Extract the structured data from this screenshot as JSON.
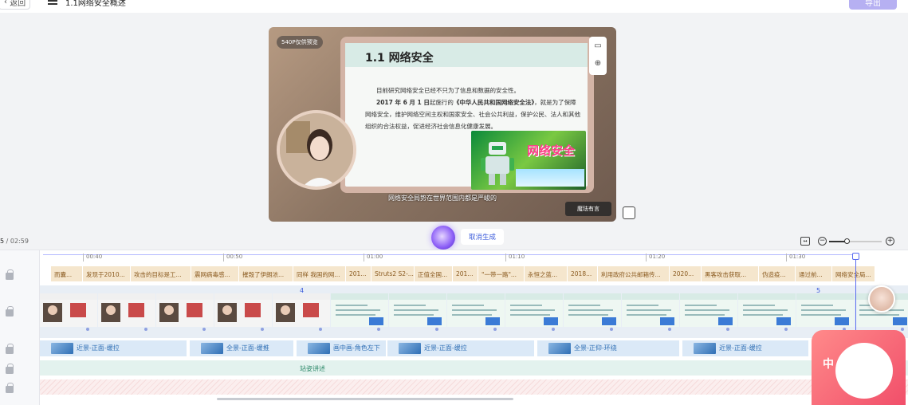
{
  "header": {
    "back_label": "返回",
    "title": "1.1网络安全概述",
    "export_label": "导出"
  },
  "preview": {
    "badge": "540P仅供预览",
    "slide_title": "1.1  网络安全",
    "slide_p1": "目前研究网络安全已经不只为了信息和数据的安全性。",
    "slide_p2_bold": "2017 年 6 月 1 日",
    "slide_p2_mid": "起施行的",
    "slide_p2_law": "《中华人民共和国网络安全法》",
    "slide_p2_rest": "，就是为了保障网络安全，维护网络空间主权和国家安全、社会公共利益，保护公民、法人和其他组织的合法权益，促进经济社会信息化健康发展。",
    "poster_text": "网络安全",
    "subtitle": "网络安全局势在世界范围内都是严峻的",
    "watermark": "魔珐有言"
  },
  "generation": {
    "cancel_label": "取消生成"
  },
  "timeline": {
    "current_time": "5",
    "total_time": "/ 02:59",
    "ruler_ticks": [
      "00:40",
      "00:50",
      "01:00",
      "01:10",
      "01:20",
      "01:30"
    ],
    "zoom_level": 0.33,
    "script_segments": [
      "而囊...",
      "发现于2010...",
      "攻击的目标是工...",
      "震网病毒感...",
      "摧毁了伊朗浓...",
      "同样 我国的网...",
      "201...",
      "Struts2 S2-...",
      "正值全国...",
      "201...",
      "\"一带一路\"...",
      "永恒之蓝...",
      "2018...",
      "利用政府公共邮箱传...",
      "2020...",
      "黑客攻击获取...",
      "伪造疫...",
      "通过前...",
      "网络安全局..."
    ],
    "scene_numbers": [
      "4",
      "5"
    ],
    "camera_segments": [
      "近景-正面-缓拉",
      "全景-正面-缓推",
      "画中画-角色左下",
      "近景-正面-缓拉",
      "全景-正仰-环绕",
      "近景-正面-缓拉"
    ],
    "pose_label": "站姿讲述",
    "mascot_char": "中"
  }
}
